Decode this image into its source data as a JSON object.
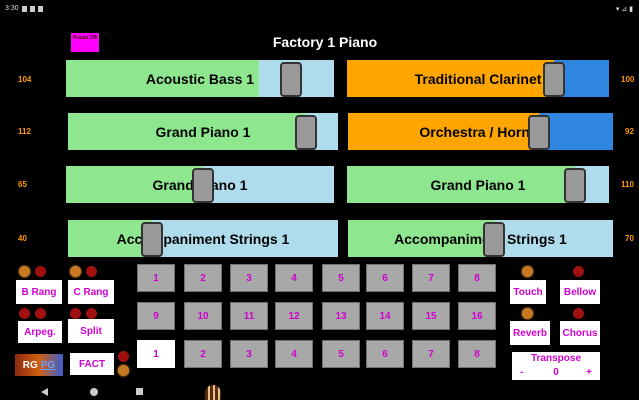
{
  "statusbar": {
    "time": "3:30",
    "right": "▾ ⊿ ▮"
  },
  "header": {
    "preset_label": "Preset Off",
    "title": "Factory 1 Piano"
  },
  "voices": [
    {
      "name": "Acoustic Bass 1",
      "color": "#8ee68e",
      "level": 0.84,
      "fill": 0.72,
      "left_value": "104",
      "right_value": ""
    },
    {
      "name": "Traditional Clarinet",
      "color": "#ffa500",
      "level": 0.79,
      "fill": 0.79,
      "left_value": "",
      "right_value": "100"
    },
    {
      "name": "Grand Piano 1",
      "color": "#8ee68e",
      "level": 0.88,
      "fill": 0.88,
      "left_value": "112",
      "right_value": ""
    },
    {
      "name": "Orchestra / Horn 1",
      "color": "#ffa500",
      "level": 0.72,
      "fill": 0.72,
      "left_value": "",
      "right_value": "92"
    },
    {
      "name": "Grand Piano 1",
      "color": "#8ee68e",
      "level": 0.51,
      "fill": 0.51,
      "left_value": "65",
      "right_value": ""
    },
    {
      "name": "Grand Piano 1",
      "color": "#8ee68e",
      "level": 0.87,
      "fill": 0.87,
      "left_value": "",
      "right_value": "110"
    },
    {
      "name": "Accompaniment Strings 1",
      "color": "#8ee68e",
      "level": 0.31,
      "fill": 0.31,
      "left_value": "40",
      "right_value": ""
    },
    {
      "name": "Accompaniment Strings 1",
      "color": "#8ee68e",
      "level": 0.55,
      "fill": 0.55,
      "left_value": "",
      "right_value": "70"
    }
  ],
  "left_buttons": {
    "b_rang": "B Rang",
    "c_rang": "C Rang",
    "arpeg": "Arpeg.",
    "split": "Split",
    "rg": "RG",
    "pg": "PG",
    "fact": "FACT"
  },
  "grid": {
    "row1": [
      "1",
      "2",
      "3",
      "4",
      "5",
      "6",
      "7",
      "8"
    ],
    "row2": [
      "9",
      "10",
      "11",
      "12",
      "13",
      "14",
      "15",
      "16"
    ],
    "row3": [
      "1",
      "2",
      "3",
      "4",
      "5",
      "6",
      "7",
      "8"
    ],
    "active_row3_index": 0
  },
  "right_buttons": {
    "touch": "Touch",
    "bellow": "Bellow",
    "reverb": "Reverb",
    "chorus": "Chorus"
  },
  "transpose": {
    "label": "Transpose",
    "minus": "-",
    "value": "0",
    "plus": "+"
  },
  "colors": {
    "green_bar": "#8ee68e",
    "orange_bar": "#ffa500",
    "track": "#aedcec",
    "blue_track": "#2e86e0",
    "button_text": "#d000d0",
    "side_numbers": "#ff9900"
  }
}
